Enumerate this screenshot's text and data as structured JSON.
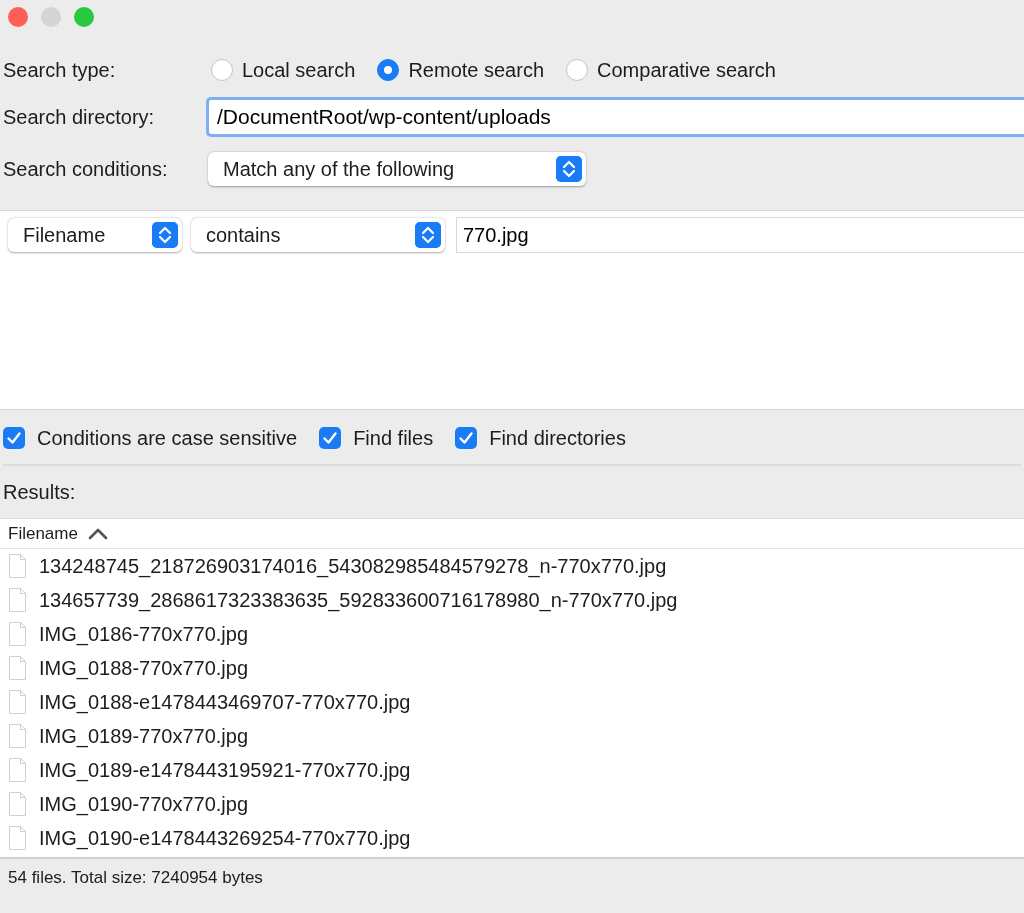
{
  "window": {
    "buttons": [
      {
        "color": "#fe5f57"
      },
      {
        "color": "#d4d4d4"
      },
      {
        "color": "#28c840"
      }
    ]
  },
  "search_type": {
    "label": "Search type:",
    "options": [
      {
        "label": "Local search",
        "selected": false
      },
      {
        "label": "Remote search",
        "selected": true
      },
      {
        "label": "Comparative search",
        "selected": false
      }
    ]
  },
  "search_directory": {
    "label": "Search directory:",
    "value": "/DocumentRoot/wp-content/uploads"
  },
  "search_conditions": {
    "label": "Search conditions:",
    "value": "Match any of the following"
  },
  "conditions": [
    {
      "field": "Filename",
      "operator": "contains",
      "value": "770.jpg"
    }
  ],
  "options": [
    {
      "label": "Conditions are case sensitive",
      "checked": true
    },
    {
      "label": "Find files",
      "checked": true
    },
    {
      "label": "Find directories",
      "checked": true
    }
  ],
  "results": {
    "label": "Results:",
    "column": "Filename",
    "sort_ascending": true,
    "files": [
      "134248745_218726903174016_543082985484579278_n-770x770.jpg",
      "134657739_2868617323383635_592833600716178980_n-770x770.jpg",
      "IMG_0186-770x770.jpg",
      "IMG_0188-770x770.jpg",
      "IMG_0188-e1478443469707-770x770.jpg",
      "IMG_0189-770x770.jpg",
      "IMG_0189-e1478443195921-770x770.jpg",
      "IMG_0190-770x770.jpg",
      "IMG_0190-e1478443269254-770x770.jpg"
    ]
  },
  "status_bar": "54 files. Total size: 7240954 bytes"
}
